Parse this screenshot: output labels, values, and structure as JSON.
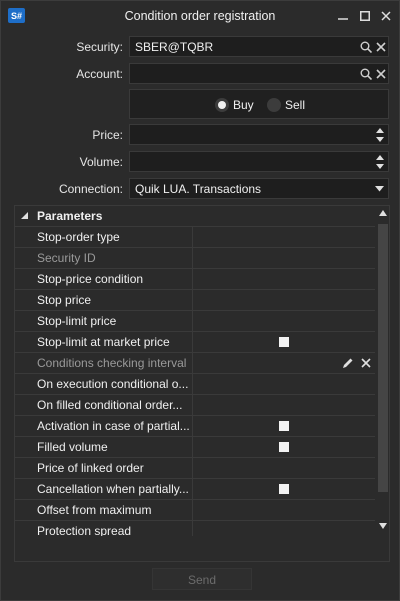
{
  "window": {
    "logo_text": "S#",
    "title": "Condition order registration"
  },
  "form": {
    "security_label": "Security:",
    "security_value": "SBER@TQBR",
    "account_label": "Account:",
    "account_value": "",
    "side": {
      "buy_label": "Buy",
      "sell_label": "Sell",
      "selected": "Buy"
    },
    "price_label": "Price:",
    "price_value": "",
    "volume_label": "Volume:",
    "volume_value": "",
    "connection_label": "Connection:",
    "connection_value": "Quik LUA. Transactions"
  },
  "parameters": {
    "header": "Parameters",
    "rows": [
      {
        "name": "Stop-order type",
        "disabled": false,
        "checkbox": false
      },
      {
        "name": "Security ID",
        "disabled": true,
        "checkbox": false
      },
      {
        "name": "Stop-price condition",
        "disabled": false,
        "checkbox": false
      },
      {
        "name": "Stop price",
        "disabled": false,
        "checkbox": false
      },
      {
        "name": "Stop-limit price",
        "disabled": false,
        "checkbox": false
      },
      {
        "name": "Stop-limit at market price",
        "disabled": false,
        "checkbox": true
      },
      {
        "name": "Conditions checking interval",
        "disabled": true,
        "checkbox": false,
        "editable": true
      },
      {
        "name": "On execution conditional o...",
        "disabled": false,
        "checkbox": false
      },
      {
        "name": "On filled conditional order...",
        "disabled": false,
        "checkbox": false
      },
      {
        "name": "Activation in case of partial...",
        "disabled": false,
        "checkbox": true
      },
      {
        "name": "Filled volume",
        "disabled": false,
        "checkbox": true
      },
      {
        "name": "Price of linked order",
        "disabled": false,
        "checkbox": false
      },
      {
        "name": "Cancellation when partially...",
        "disabled": false,
        "checkbox": true
      },
      {
        "name": "Offset from maximum",
        "disabled": false,
        "checkbox": false
      },
      {
        "name": "Protection spread",
        "disabled": false,
        "checkbox": false
      }
    ]
  },
  "footer": {
    "send_label": "Send"
  },
  "colors": {
    "background": "#2b2b2b",
    "field": "#1e1e1e",
    "logo": "#1e6ec8",
    "disabled_text": "#9a9a9a"
  }
}
